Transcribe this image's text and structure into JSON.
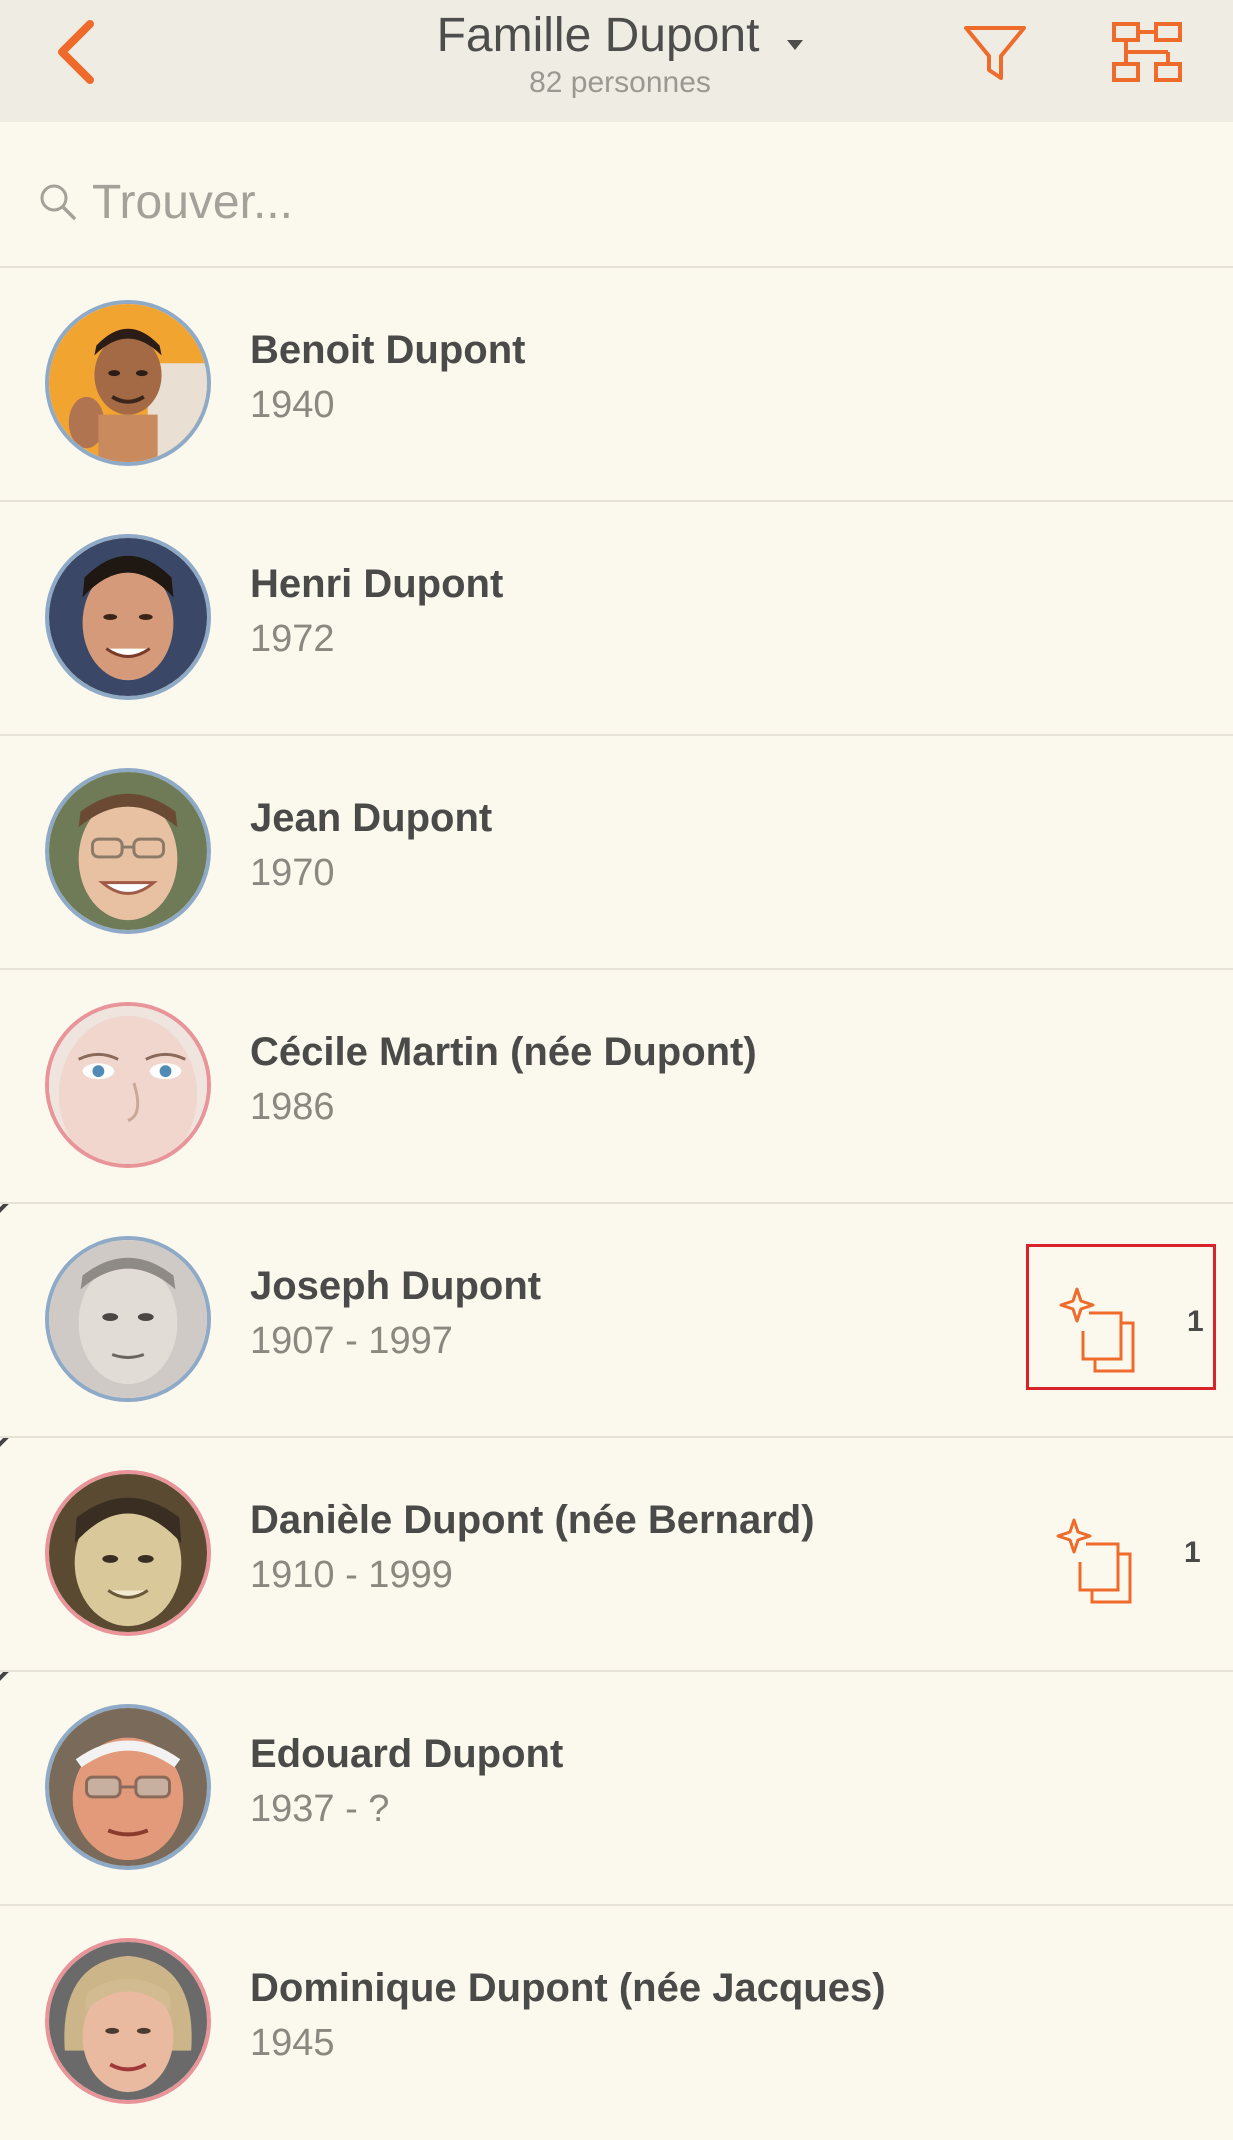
{
  "header": {
    "title": "Famille Dupont",
    "subtitle": "82 personnes",
    "back_icon": "chevron-left-icon",
    "filter_icon": "filter-icon",
    "tree_icon": "tree-view-icon",
    "accent_color": "#ef6b2b"
  },
  "search": {
    "placeholder": "Trouver...",
    "value": ""
  },
  "people": [
    {
      "name": "Benoit Dupont",
      "years": "1940",
      "gender": "male",
      "deceased": false,
      "hints": null
    },
    {
      "name": "Henri Dupont",
      "years": "1972",
      "gender": "male",
      "deceased": false,
      "hints": null
    },
    {
      "name": "Jean Dupont",
      "years": "1970",
      "gender": "male",
      "deceased": false,
      "hints": null
    },
    {
      "name": "Cécile Martin (née Dupont)",
      "years": "1986",
      "gender": "female",
      "deceased": false,
      "hints": null
    },
    {
      "name": "Joseph Dupont",
      "years": "1907 - 1997",
      "gender": "male",
      "deceased": true,
      "hints": "1",
      "hint_highlighted": true
    },
    {
      "name": "Danièle Dupont (née Bernard)",
      "years": "1910 - 1999",
      "gender": "female",
      "deceased": true,
      "hints": "1"
    },
    {
      "name": "Edouard Dupont",
      "years": "1937 - ?",
      "gender": "male",
      "deceased": true,
      "hints": null
    },
    {
      "name": "Dominique Dupont (née Jacques)",
      "years": "1945",
      "gender": "female",
      "deceased": false,
      "hints": null
    }
  ],
  "colors": {
    "male_ring": "#8eaac6",
    "female_ring": "#e89498",
    "highlight_box": "#d9232b"
  }
}
